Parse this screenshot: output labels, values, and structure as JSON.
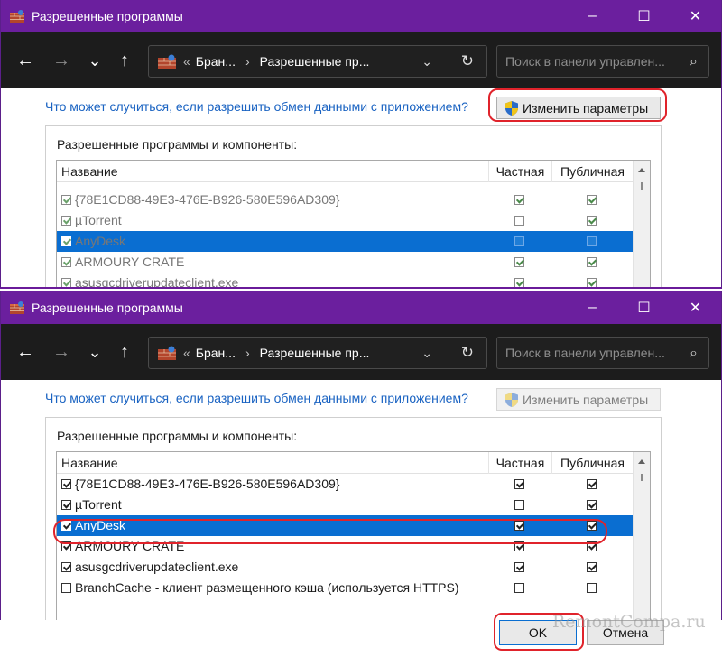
{
  "window": {
    "title": "Разрешенные программы",
    "minimize": "–",
    "maximize": "☐",
    "close": "✕"
  },
  "nav": {
    "back": "←",
    "forward": "→",
    "recent": "⌄",
    "up": "↑"
  },
  "address": {
    "sep": "«",
    "crumb1": "Бран...",
    "chevron": "›",
    "crumb2": "Разрешенные пр...",
    "dropdown": "⌄",
    "refresh": "↻"
  },
  "search": {
    "placeholder": "Поиск в панели управлен...",
    "icon": "⌕"
  },
  "content": {
    "risk_link": "Что может случиться, если разрешить обмен данными с приложением?",
    "change_button": "Изменить параметры",
    "group_label": "Разрешенные программы и компоненты:",
    "columns": {
      "name": "Название",
      "private": "Частная",
      "public": "Публичная"
    }
  },
  "top_list": {
    "cut_name": "",
    "rows": [
      {
        "name": "{78E1CD88-49E3-476E-B926-580E596AD309}",
        "enabled": true,
        "private": true,
        "public": true
      },
      {
        "name": "µTorrent",
        "enabled": true,
        "private": false,
        "public": true
      },
      {
        "name": "AnyDesk",
        "enabled": true,
        "private": false,
        "public": false,
        "selected": true
      },
      {
        "name": "ARMOURY CRATE",
        "enabled": true,
        "private": true,
        "public": true
      },
      {
        "name": "asusgcdriverupdateclient.exe",
        "enabled": true,
        "private": true,
        "public": true
      }
    ]
  },
  "bottom_list": {
    "rows": [
      {
        "name": "{78E1CD88-49E3-476E-B926-580E596AD309}",
        "enabled": true,
        "private": true,
        "public": true
      },
      {
        "name": "µTorrent",
        "enabled": true,
        "private": false,
        "public": true
      },
      {
        "name": "AnyDesk",
        "enabled": true,
        "private": true,
        "public": true,
        "selected": true
      },
      {
        "name": "ARMOURY CRATE",
        "enabled": true,
        "private": true,
        "public": true
      },
      {
        "name": "asusgcdriverupdateclient.exe",
        "enabled": true,
        "private": true,
        "public": true
      },
      {
        "name": "BranchCache - клиент размещенного кэша (используется HTTPS)",
        "enabled": false,
        "private": false,
        "public": false
      }
    ]
  },
  "buttons": {
    "ok": "OK",
    "cancel": "Отмена"
  },
  "watermark": "RemontCompa.ru",
  "colors": {
    "titlebar": "#6b1f9e",
    "navbar": "#1c1c1c",
    "selection": "#0a6ed1",
    "link": "#1a63c2",
    "highlight_circle": "#e0232b"
  }
}
